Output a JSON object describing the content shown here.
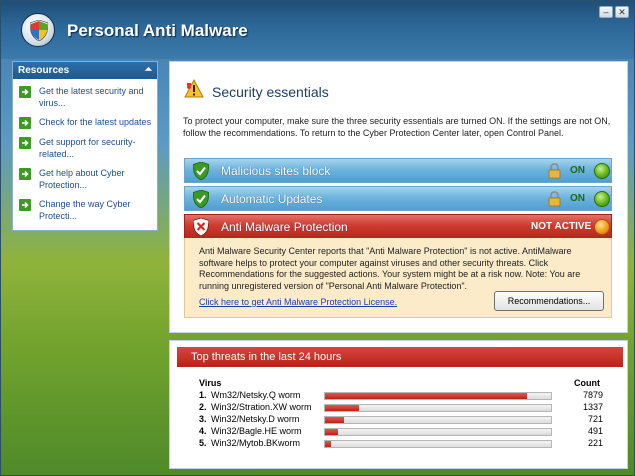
{
  "window": {
    "title": "Personal Anti Malware",
    "minimize_glyph": "–",
    "close_glyph": "✕"
  },
  "sidebar": {
    "header": "Resources",
    "collapse_glyph": "⏶",
    "items": [
      {
        "label": "Get the latest security and virus..."
      },
      {
        "label": "Check for the latest updates"
      },
      {
        "label": "Get support for security-related..."
      },
      {
        "label": "Get help about Cyber Protection..."
      },
      {
        "label": "Change the way Cyber Protecti..."
      }
    ]
  },
  "main": {
    "title": "Security essentials",
    "intro": "To protect your computer, make sure the three security essentials are turned ON. If the settings are not ON, follow the recommendations. To return to the Cyber Protection Center later, open Control Panel.",
    "essentials": [
      {
        "label": "Malicious sites block",
        "status": "ON"
      },
      {
        "label": "Automatic Updates",
        "status": "ON"
      },
      {
        "label": "Anti Malware Protection",
        "status": "NOT ACTIVE"
      }
    ],
    "alert_text": "Anti Malware Security Center reports that \"Anti Malware Protection\" is not active. AntiMalware software helps to protect your computer against viruses and other security threats. Click Recommendations for the suggested actions. Your system might be at a risk now. Note: You are running unregistered version of \"Personal Anti Malware Protection\".",
    "alert_link": "Click here to get Anti Malware Protection License.",
    "recommendations_button": "Recommendations..."
  },
  "threats": {
    "title": "Top threats in the last 24 hours",
    "col_virus": "Virus",
    "col_count": "Count",
    "max_count": 7879,
    "rows": [
      {
        "num": "1.",
        "name": "Wm32/Netsky.Q worm",
        "count": 7879
      },
      {
        "num": "2.",
        "name": "Win32/Stration.XW worm",
        "count": 1337
      },
      {
        "num": "3.",
        "name": "Win32/Netsky.D worm",
        "count": 721
      },
      {
        "num": "4.",
        "name": "Win32/Bagle.HE worm",
        "count": 491
      },
      {
        "num": "5.",
        "name": "Win32/Mytob.BKworm",
        "count": 221
      }
    ]
  },
  "colors": {
    "accent_blue": "#2e6ea8",
    "status_on": "#1f6a10",
    "status_alert": "#cf3b30"
  }
}
